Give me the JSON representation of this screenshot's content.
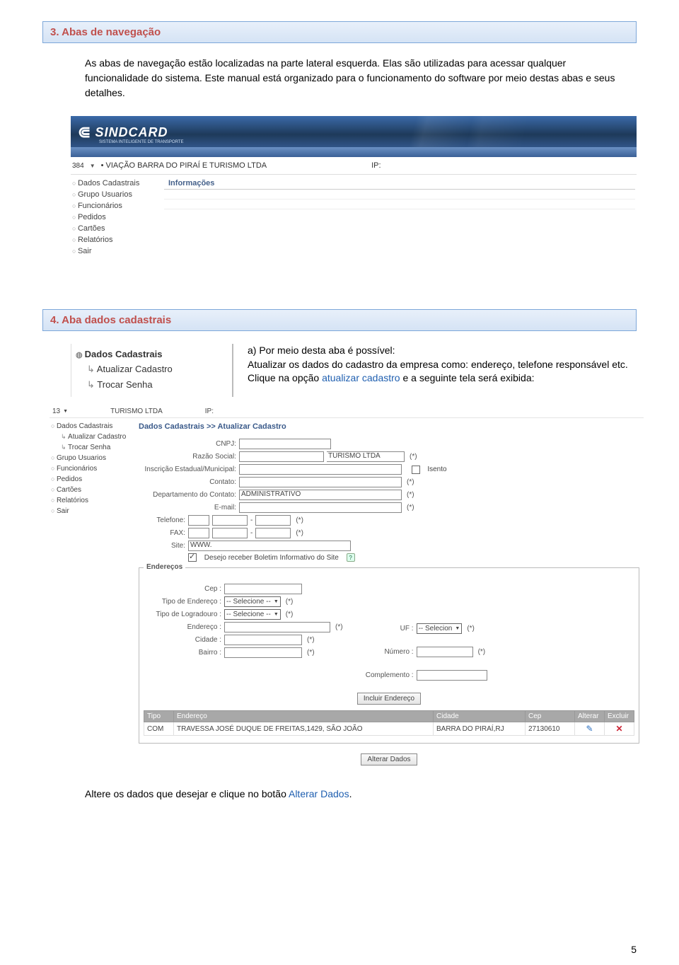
{
  "section3": {
    "title": "3. Abas de navegação",
    "paragraph": "As abas de navegação estão localizadas na parte lateral esquerda. Elas são utilizadas para acessar qualquer funcionalidade do sistema. Este manual está organizado para o funcionamento do software por meio destas abas e seus detalhes."
  },
  "shot1": {
    "logo_text": "SINDCARD",
    "logo_sub": "SISTEMA INTELIGENTE DE TRANSPORTE",
    "code": "384",
    "company": "• VIAÇÃO BARRA DO PIRAÍ E TURISMO LTDA",
    "ip_label": "IP:",
    "menu": [
      "Dados Cadastrais",
      "Grupo Usuarios",
      "Funcionários",
      "Pedidos",
      "Cartões",
      "Relatórios",
      "Sair"
    ],
    "tab": "Informações"
  },
  "section4": {
    "title": "4. Aba dados cadastrais",
    "mini": {
      "head": "Dados Cadastrais",
      "sub1": "Atualizar Cadastro",
      "sub2": "Trocar Senha"
    },
    "desc_a": "a)   Por meio desta aba é possível:",
    "desc_line": "Atualizar os dados do cadastro da empresa como: endereço, telefone responsável etc.",
    "desc_click_pre": "Clique na opção ",
    "desc_click_link": "atualizar cadastro",
    "desc_click_post": " e a seguinte tela será exibida:"
  },
  "shot2": {
    "code": "13",
    "company": "TURISMO LTDA",
    "ip_label": "IP:",
    "menu": [
      "Dados Cadastrais"
    ],
    "submenu": [
      "Atualizar Cadastro",
      "Trocar Senha"
    ],
    "menu_rest": [
      "Grupo Usuarios",
      "Funcionários",
      "Pedidos",
      "Cartões",
      "Relatórios",
      "Sair"
    ],
    "breadcrumb": "Dados Cadastrais  >>  Atualizar Cadastro",
    "labels": {
      "cnpj": "CNPJ:",
      "razao": "Razão Social:",
      "razao_val": "TURISMO LTDA",
      "insc": "Inscrição Estadual/Municipal:",
      "isento": "Isento",
      "contato": "Contato:",
      "dept": "Departamento do Contato:",
      "dept_val": "ADMINISTRATIVO",
      "email": "E-mail:",
      "tel": "Telefone:",
      "fax": "FAX:",
      "site": "Site:",
      "site_val": "WWW.",
      "boletim": "Desejo receber Boletim Informativo do Site",
      "ast": "(*)"
    },
    "enderecos": {
      "legend": "Endereços",
      "cep": "Cep :",
      "tipo_end": "Tipo de Endereço :",
      "tipo_log": "Tipo de Logradouro :",
      "selecione": "-- Selecione --",
      "endereco": "Endereço :",
      "cidade": "Cidade :",
      "bairro": "Bairro :",
      "uf": "UF :",
      "uf_val": "-- Selecion",
      "numero": "Número :",
      "comp": "Complemento :",
      "btn_incluir": "Incluir Endereço"
    },
    "table": {
      "h_tipo": "Tipo",
      "h_end": "Endereço",
      "h_cid": "Cidade",
      "h_cep": "Cep",
      "h_alt": "Alterar",
      "h_exc": "Excluir",
      "r_tipo": "COM",
      "r_end": "TRAVESSA JOSÉ DUQUE DE FREITAS,1429, SÃO JOÃO",
      "r_cid": "BARRA DO PIRAÍ,RJ",
      "r_cep": "27130610"
    },
    "btn_alterar": "Alterar Dados"
  },
  "footer": {
    "pre": "Altere os dados que desejar e clique no botão ",
    "link": "Alterar Dados",
    "post": "."
  },
  "page_number": "5"
}
